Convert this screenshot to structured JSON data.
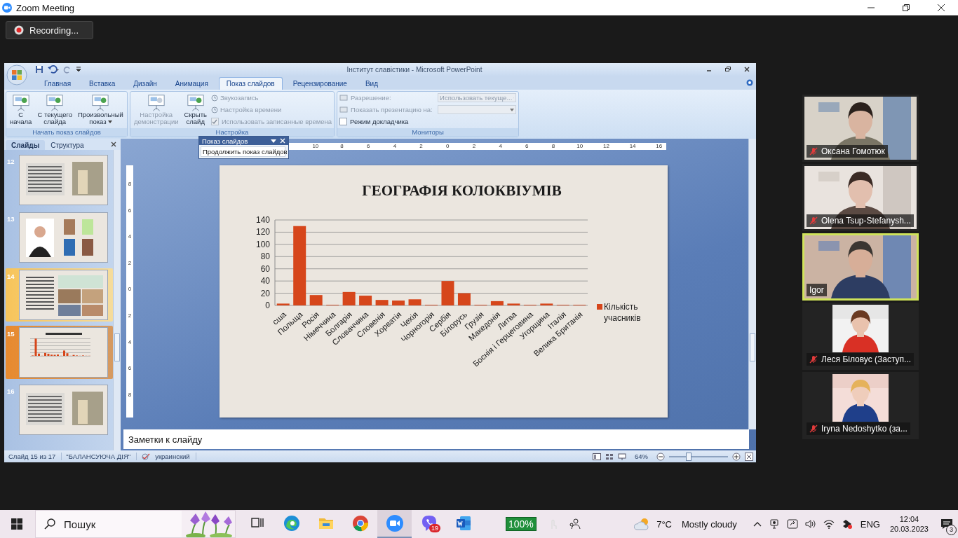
{
  "window": {
    "title": "Zoom Meeting"
  },
  "recording": {
    "label": "Recording..."
  },
  "powerpoint": {
    "title": "Інститут славістики - Microsoft PowerPoint",
    "tabs": [
      {
        "label": "Главная",
        "selected": false
      },
      {
        "label": "Вставка",
        "selected": false
      },
      {
        "label": "Дизайн",
        "selected": false
      },
      {
        "label": "Анимация",
        "selected": false
      },
      {
        "label": "Показ слайдов",
        "selected": true
      },
      {
        "label": "Рецензирование",
        "selected": false
      },
      {
        "label": "Вид",
        "selected": false
      }
    ],
    "ribbon_groups": [
      {
        "label": "Начать показ слайдов",
        "columns": [
          [
            {
              "kind": "large",
              "label": "С\nначала",
              "disabled": false
            }
          ],
          [
            {
              "kind": "large",
              "label": "С текущего\nслайда",
              "disabled": false
            }
          ],
          [
            {
              "kind": "large",
              "label": "Произвольный\nпоказ",
              "disabled": false,
              "dropdown": true
            }
          ]
        ]
      },
      {
        "label": "Настройка",
        "columns": [
          [
            {
              "kind": "large",
              "label": "Настройка\nдемонстрации",
              "disabled": true
            }
          ],
          [
            {
              "kind": "large",
              "label": "Скрыть\nслайд",
              "disabled": false
            }
          ],
          [
            {
              "kind": "small",
              "label": "Звукозапись",
              "disabled": true
            },
            {
              "kind": "small",
              "label": "Настройка времени",
              "disabled": true
            },
            {
              "kind": "checkbox",
              "label": "Использовать записанные времена",
              "disabled": true,
              "checked": true
            }
          ]
        ]
      },
      {
        "label": "Мониторы",
        "columns": [
          [
            {
              "kind": "dropdown",
              "label": "Разрешение:",
              "value": "Использовать текуще...",
              "disabled": true
            },
            {
              "kind": "dropdown",
              "label": "Показать презентацию на:",
              "disabled": true
            },
            {
              "kind": "checkbox",
              "label": "Режим докладчика",
              "disabled": false,
              "checked": false
            }
          ]
        ]
      }
    ],
    "floating_toolbar": {
      "title": "Показ слайдов",
      "button": "Продолжить показ слайдов"
    },
    "slides_pane": {
      "tabs": [
        {
          "label": "Слайды",
          "selected": true
        },
        {
          "label": "Структура",
          "selected": false
        }
      ],
      "slides": [
        {
          "number": "12",
          "kind": "text-photo",
          "selected": false,
          "highlighted": false
        },
        {
          "number": "13",
          "kind": "person-books",
          "selected": false,
          "highlighted": false
        },
        {
          "number": "14",
          "kind": "collage",
          "selected": false,
          "highlighted": true
        },
        {
          "number": "15",
          "kind": "chart",
          "selected": true,
          "highlighted": false
        },
        {
          "number": "16",
          "kind": "text-photo",
          "selected": false,
          "highlighted": false
        }
      ]
    },
    "rulers": {
      "horizontal": [
        "10",
        "8",
        "6",
        "4",
        "2",
        "0",
        "2",
        "4",
        "6",
        "8",
        "10",
        "12",
        "14",
        "16"
      ],
      "vertical": [
        "8",
        "6",
        "4",
        "2",
        "0",
        "2",
        "4",
        "6",
        "8"
      ]
    },
    "slide": {
      "chart_data": {
        "type": "bar",
        "title": "ГЕОГРАФІЯ КОЛОКВІУМІВ",
        "categories": [
          "сша",
          "Польща",
          "Росія",
          "Німеччина",
          "Болгарія",
          "Словаччина",
          "Словенія",
          "Хорватія",
          "Чехія",
          "Чорногорія",
          "Сербія",
          "Білорусь",
          "Грузія",
          "Македонія",
          "Литва",
          "Боснія і Герцеговина",
          "Угорщина",
          "Італія",
          "Велика Британія"
        ],
        "series": [
          {
            "name": "Кількість учасників",
            "color": "#d6461b",
            "values": [
              3,
              130,
              17,
              1,
              22,
              16,
              9,
              8,
              10,
              1,
              40,
              20,
              1,
              7,
              3,
              1,
              3,
              1,
              1
            ]
          }
        ],
        "grid": true,
        "ylim": [
          0,
          140
        ],
        "yticks": [
          0,
          20,
          40,
          60,
          80,
          100,
          120,
          140
        ]
      }
    },
    "notes": {
      "text": "Заметки к слайду"
    },
    "status_bar": {
      "slide": "Слайд 15 из 17",
      "theme": "\"БАЛАНСУЮЧА ДІЯ\"",
      "language": "украинский",
      "zoom": "64%",
      "zoom_slider": {
        "level": 0.32
      }
    }
  },
  "participants": [
    {
      "name": "Оксана Гомотюк",
      "kind": "video",
      "muted": true,
      "speaking": false
    },
    {
      "name": "Olena Tsup-Stefanysh...",
      "kind": "video",
      "muted": true,
      "speaking": false
    },
    {
      "name": "Igor",
      "kind": "video",
      "muted": false,
      "speaking": true
    },
    {
      "name": "Леся Біловус (Заступ...",
      "muted": true,
      "speaking": false
    },
    {
      "name": "Iryna Nedoshytko (за...",
      "muted": true,
      "speaking": false
    }
  ],
  "taskbar": {
    "search": {
      "placeholder": "Пошук"
    },
    "apps": [
      {
        "kind": "task-view",
        "selected": false
      },
      {
        "kind": "edge",
        "selected": false
      },
      {
        "kind": "explorer",
        "selected": false
      },
      {
        "kind": "chrome",
        "selected": false
      },
      {
        "kind": "zoom",
        "selected": true
      },
      {
        "kind": "viber",
        "selected": false,
        "badge": "19"
      },
      {
        "kind": "word",
        "selected": false
      }
    ],
    "battery": "100%",
    "weather": {
      "temperature": "7°C",
      "condition": "Mostly cloudy"
    },
    "language": "ENG",
    "time": "12:04",
    "date": "20.03.2023",
    "notifications": "3"
  }
}
